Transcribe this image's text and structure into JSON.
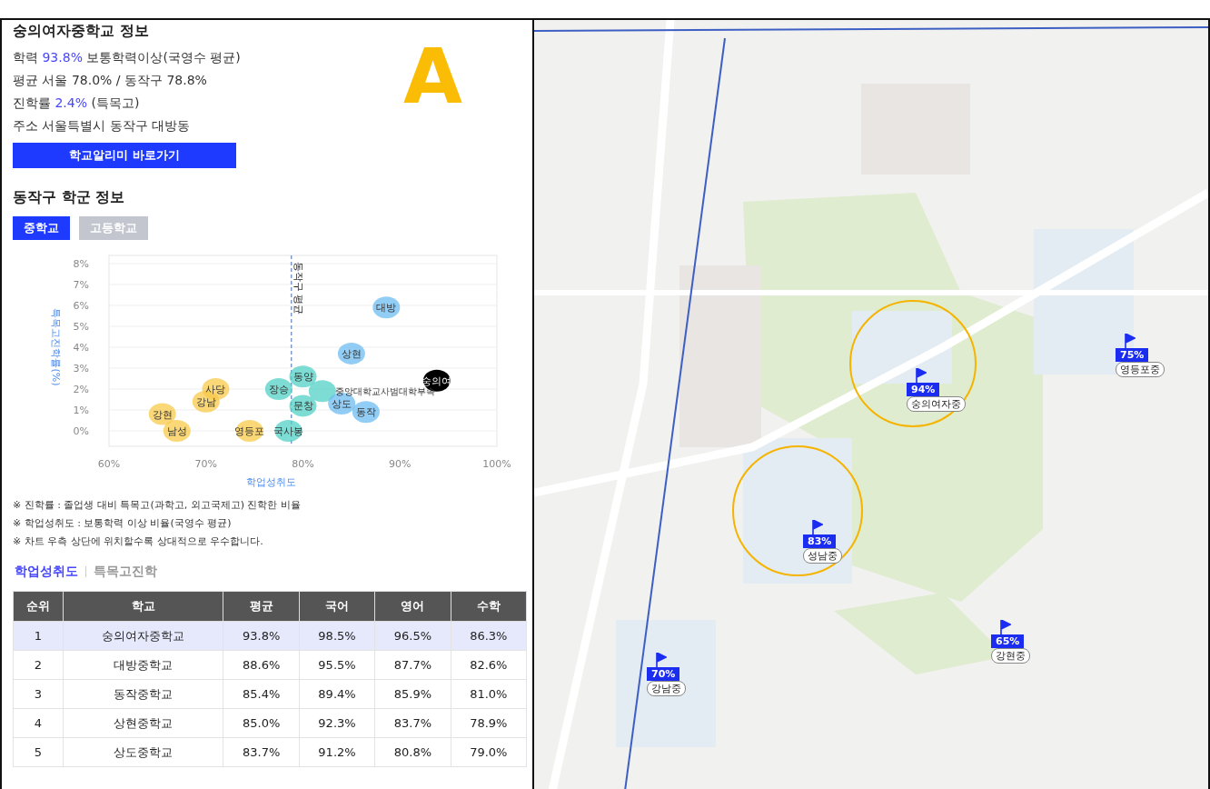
{
  "school_info": {
    "title": "숭의여자중학교 정보",
    "lines": [
      {
        "label": "학력",
        "highlight": "93.8%",
        "rest": "보통학력이상(국영수 평균)"
      },
      {
        "label": "평균",
        "rest": "서울 78.0% / 동작구 78.8%"
      },
      {
        "label": "진학률",
        "highlight": "2.4%",
        "rest": "(특목고)"
      },
      {
        "label": "주소",
        "rest": "서울특별시 동작구 대방동"
      }
    ],
    "link_button": "학교알리미 바로가기"
  },
  "annotation_letter": "A",
  "district": {
    "title": "동작구 학군 정보",
    "tabs": [
      {
        "label": "중학교",
        "selected": true
      },
      {
        "label": "고등학교",
        "selected": false
      }
    ],
    "chart": {
      "chart_data": {
        "type": "scatter",
        "xlabel": "학업성취도",
        "ylabel": "특목고진학률(%)",
        "xlim": [
          60,
          100
        ],
        "ylim": [
          -0.74,
          8.39
        ],
        "grid": true,
        "xticks": [
          {
            "value": 60,
            "label": "60%"
          },
          {
            "value": 70,
            "label": "70%"
          },
          {
            "value": 80,
            "label": "80%"
          },
          {
            "value": 90,
            "label": "90%"
          },
          {
            "value": 100,
            "label": "100%"
          }
        ],
        "yticks": [
          {
            "value": 0,
            "label": "0%"
          },
          {
            "value": 1,
            "label": "1%"
          },
          {
            "value": 2,
            "label": "2%"
          },
          {
            "value": 3,
            "label": "3%"
          },
          {
            "value": 4,
            "label": "4%"
          },
          {
            "value": 5,
            "label": "5%"
          },
          {
            "value": 6,
            "label": "6%"
          },
          {
            "value": 7,
            "label": "7%"
          },
          {
            "value": 8,
            "label": "8%"
          }
        ],
        "series": [
          {
            "name": "사당",
            "color": "#f8c94a",
            "x": [
              71
            ],
            "values": [
              2.0
            ]
          },
          {
            "name": "강남",
            "color": "#f8c94a",
            "x": [
              70
            ],
            "values": [
              1.4
            ]
          },
          {
            "name": "강현",
            "color": "#f8c94a",
            "x": [
              65.5
            ],
            "values": [
              0.8
            ]
          },
          {
            "name": "남성",
            "color": "#f8c94a",
            "x": [
              67
            ],
            "values": [
              0
            ]
          },
          {
            "name": "영등포",
            "color": "#f8c94a",
            "x": [
              74.5
            ],
            "values": [
              0
            ]
          },
          {
            "name": "동양",
            "color": "#52d0c4",
            "x": [
              80
            ],
            "values": [
              2.6
            ]
          },
          {
            "name": "장승",
            "color": "#52d0c4",
            "x": [
              77.5
            ],
            "values": [
              2.0
            ]
          },
          {
            "name": "문창",
            "color": "#52d0c4",
            "x": [
              80
            ],
            "values": [
              1.2
            ]
          },
          {
            "name": "중앙대학교사범대학부속",
            "color": "#52d0c4",
            "x": [
              82
            ],
            "values": [
              1.9
            ]
          },
          {
            "name": "국사봉",
            "color": "#52d0c4",
            "x": [
              78.5
            ],
            "values": [
              0
            ]
          },
          {
            "name": "대방",
            "color": "#6cbcf0",
            "x": [
              88.6
            ],
            "values": [
              5.9
            ]
          },
          {
            "name": "상현",
            "color": "#6cbcf0",
            "x": [
              85
            ],
            "values": [
              3.7
            ]
          },
          {
            "name": "상도",
            "color": "#6cbcf0",
            "x": [
              84
            ],
            "values": [
              1.3
            ]
          },
          {
            "name": "동작",
            "color": "#6cbcf0",
            "x": [
              86.5
            ],
            "values": [
              0.9
            ]
          },
          {
            "name": "숭의여",
            "color": "#000000",
            "x": [
              93.8
            ],
            "values": [
              2.4
            ]
          }
        ],
        "ref_lines": [
          {
            "axis": "x",
            "value": 78.8,
            "label": "동작구 평균"
          }
        ]
      }
    },
    "notes": [
      "※ 진학률 : 졸업생 대비 특목고(과학고, 외고국제고) 진학한 비율",
      "※ 학업성취도 : 보통학력 이상 비율(국영수 평균)",
      "※ 차트 우측 상단에 위치할수록 상대적으로 우수합니다."
    ],
    "table_tabs": [
      {
        "label": "학업성취도",
        "selected": true
      },
      {
        "label": "특목고진학",
        "selected": false
      }
    ],
    "table": {
      "columns": [
        "순위",
        "학교",
        "평균",
        "국어",
        "영어",
        "수학"
      ],
      "rows": [
        {
          "selected": true,
          "cells": [
            "1",
            "숭의여자중학교",
            "93.8%",
            "98.5%",
            "96.5%",
            "86.3%"
          ]
        },
        {
          "selected": false,
          "cells": [
            "2",
            "대방중학교",
            "88.6%",
            "95.5%",
            "87.7%",
            "82.6%"
          ]
        },
        {
          "selected": false,
          "cells": [
            "3",
            "동작중학교",
            "85.4%",
            "89.4%",
            "85.9%",
            "81.0%"
          ]
        },
        {
          "selected": false,
          "cells": [
            "4",
            "상현중학교",
            "85.0%",
            "92.3%",
            "83.7%",
            "78.9%"
          ]
        },
        {
          "selected": false,
          "cells": [
            "5",
            "상도중학교",
            "83.7%",
            "91.2%",
            "80.8%",
            "79.0%"
          ]
        }
      ]
    }
  },
  "map": {
    "kind": "picture",
    "markers": [
      {
        "percent": "75%",
        "name": "영등포중",
        "circled": false
      },
      {
        "percent": "94%",
        "name": "숭의여자중",
        "circled": true
      },
      {
        "percent": "83%",
        "name": "성남중",
        "circled": true
      },
      {
        "percent": "65%",
        "name": "강현중",
        "circled": false
      },
      {
        "percent": "70%",
        "name": "강남중",
        "circled": false
      }
    ]
  }
}
